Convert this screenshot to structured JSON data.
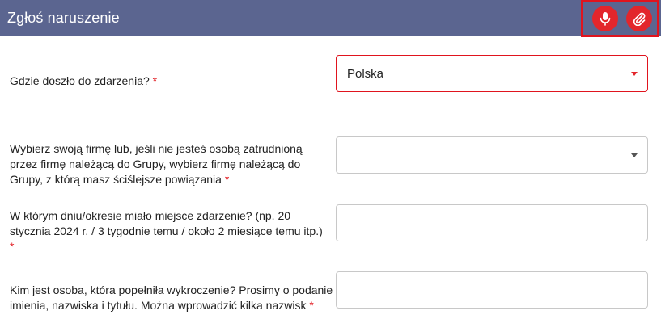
{
  "header": {
    "title": "Zgłoś naruszenie",
    "colors": {
      "bar": "#5b6590",
      "accent": "#e3262c",
      "highlight": "#e0141e"
    },
    "actions": [
      {
        "icon": "microphone-icon"
      },
      {
        "icon": "paperclip-icon"
      }
    ]
  },
  "form": {
    "required_mark": "*",
    "fields": [
      {
        "label": "Gdzie doszło do zdarzenia?",
        "type": "select",
        "value": "Polska"
      },
      {
        "label_lines": [
          "Wybierz swoją firmę lub, jeśli nie jesteś osobą zatrudnioną",
          "przez firmę należącą do Grupy, wybierz firmę należącą do",
          "Grupy, z którą masz ściślejsze powiązania"
        ],
        "type": "select",
        "value": ""
      },
      {
        "label_lines": [
          "W którym dniu/okresie miało miejsce zdarzenie? (np. 20",
          "stycznia 2024 r. / 3 tygodnie temu / około 2 miesiące temu itp.)"
        ],
        "type": "text",
        "value": ""
      },
      {
        "label_lines": [
          "Kim jest osoba, która popełniła wykroczenie? Prosimy o podanie",
          "imienia, nazwiska i tytułu. Można wprowadzić kilka nazwisk"
        ],
        "type": "text",
        "value": ""
      }
    ]
  }
}
